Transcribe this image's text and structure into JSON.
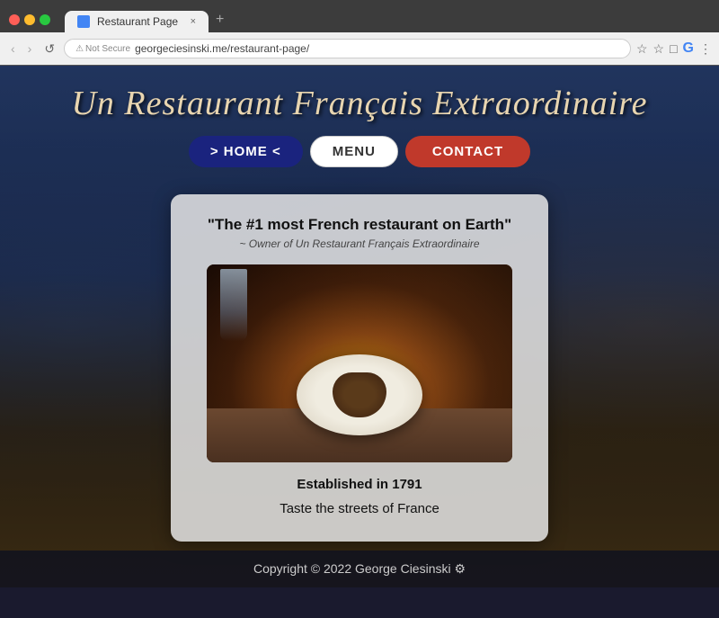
{
  "browser": {
    "tab_title": "Restaurant Page",
    "close_label": "×",
    "new_tab_label": "+",
    "back_label": "‹",
    "forward_label": "›",
    "reload_label": "↺",
    "security_warning": "Not Secure",
    "url": "georgeciesinski.me/restaurant-page/",
    "bookmark_icon": "☆",
    "extensions_icon": "□",
    "google_icon": "G",
    "menu_icon": "⋮"
  },
  "site": {
    "title": "Un Restaurant Français Extraordinaire",
    "nav": {
      "home_label": "> HOME <",
      "menu_label": "MENU",
      "contact_label": "CONTACT"
    },
    "quote": {
      "main": "\"The #1 most French restaurant on Earth\"",
      "attribution": "~ Owner of Un Restaurant Français Extraordinaire"
    },
    "established": "Established in 1791",
    "tagline": "Taste the streets of France",
    "footer": "Copyright © 2022 George Ciesinski ⚙"
  }
}
